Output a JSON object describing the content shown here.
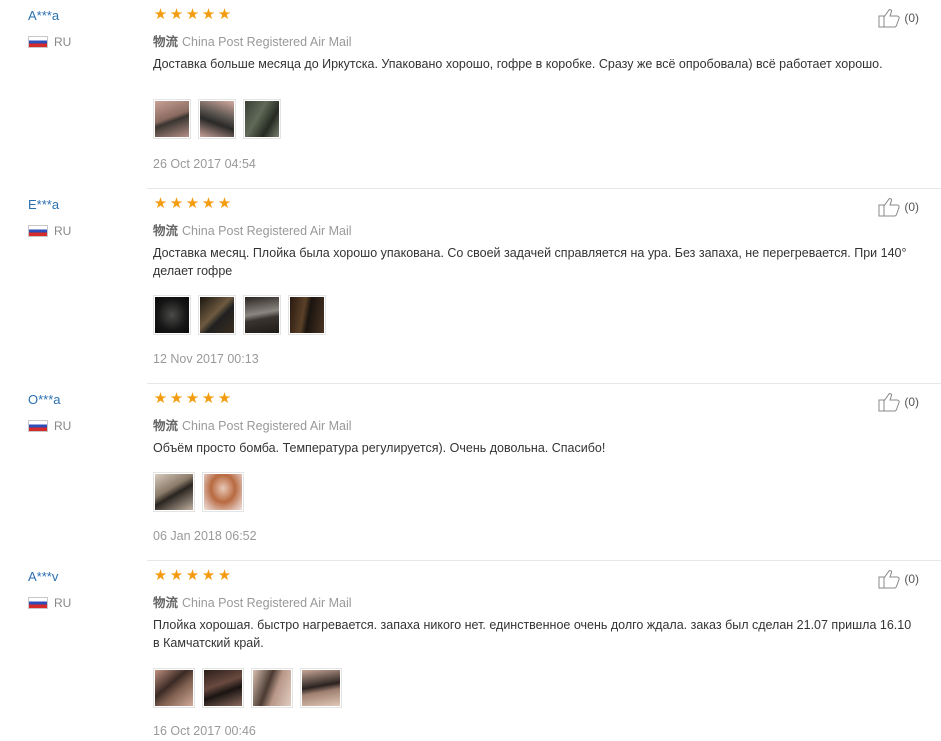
{
  "reviews": [
    {
      "name": "A***a",
      "country": "RU",
      "stars": 5,
      "logistics_label": "物流",
      "logistics": "China Post Registered Air Mail",
      "text": "Доставка больше месяца до Иркутска. Упаковано хорошо, гофре в коробке. Сразу же всё опробовала) всё работает хорошо.",
      "date": "26 Oct 2017 04:54",
      "useful": "(0)",
      "photos": 3
    },
    {
      "name": "E***a",
      "country": "RU",
      "stars": 5,
      "logistics_label": "物流",
      "logistics": "China Post Registered Air Mail",
      "text": "Доставка месяц. Плойка была хорошо упакована. Со своей задачей справляется на ура. Без запаха, не перегревается. При 140° делает гофре",
      "date": "12 Nov 2017 00:13",
      "useful": "(0)",
      "photos": 4
    },
    {
      "name": "O***a",
      "country": "RU",
      "stars": 5,
      "logistics_label": "物流",
      "logistics": "China Post Registered Air Mail",
      "text": "Объём просто бомба. Температура регулируется). Очень довольна. Спасибо!",
      "date": "06 Jan 2018 06:52",
      "useful": "(0)",
      "photos": 2
    },
    {
      "name": "A***v",
      "country": "RU",
      "stars": 5,
      "logistics_label": "物流",
      "logistics": "China Post Registered Air Mail",
      "text": "Плойка хорошая. быстро нагревается. запаха никого нет. единственное очень долго ждала. заказ был сделан 21.07 пришла 16.10 в Камчатский край.",
      "date": "16 Oct 2017 00:46",
      "useful": "(0)",
      "photos": 4
    }
  ],
  "icons": {
    "star": "star-icon",
    "flag": "russia-flag-icon",
    "thumb": "thumbs-up-icon"
  },
  "colors": {
    "star": "#f39c12",
    "name_link": "#2a6fb0",
    "muted": "#999999"
  }
}
